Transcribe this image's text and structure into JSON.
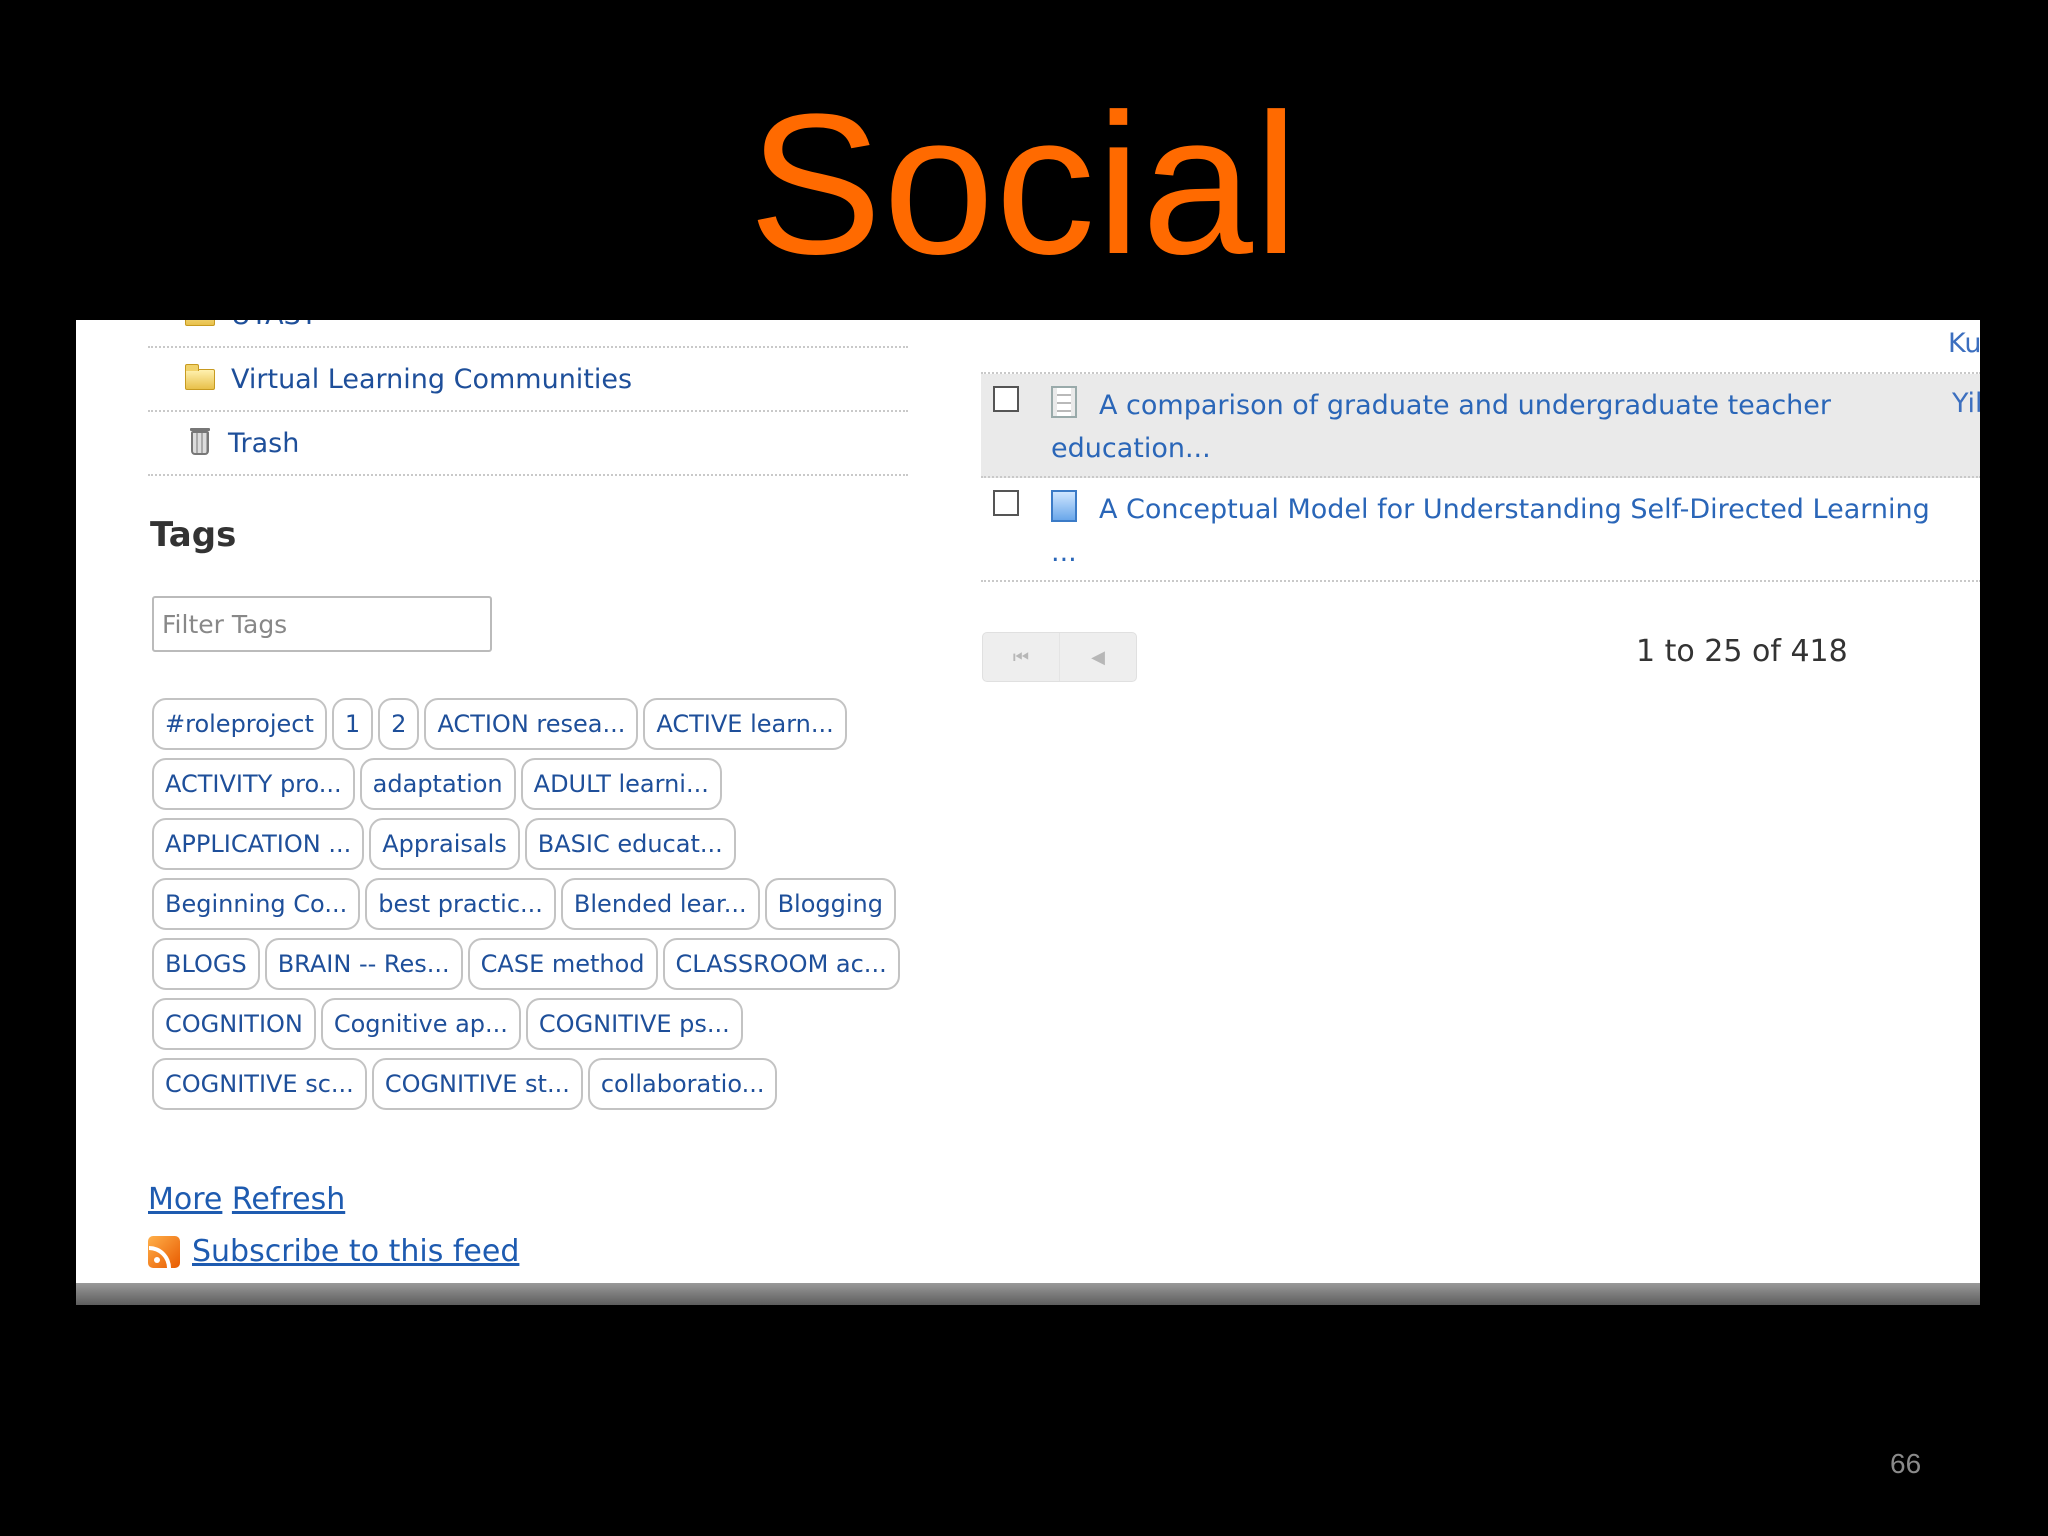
{
  "slide": {
    "title": "Social",
    "number": "66",
    "title_color": "#ff6a00"
  },
  "sidebar": {
    "folder_partial": "UTAST",
    "folders": [
      {
        "label": "Virtual Learning Communities",
        "icon": "folder-icon"
      },
      {
        "label": "Trash",
        "icon": "trash-icon"
      }
    ],
    "tags_heading": "Tags",
    "tag_filter_placeholder": "Filter Tags",
    "tags": [
      "#roleproject",
      "1",
      "2",
      "ACTION resea...",
      "ACTIVE learn...",
      "ACTIVITY pro...",
      "adaptation",
      "ADULT learni...",
      "APPLICATION ...",
      "Appraisals",
      "BASIC educat...",
      "Beginning Co...",
      "best practic...",
      "Blended lear...",
      "Blogging",
      "BLOGS",
      "BRAIN -- Res...",
      "CASE method",
      "CLASSROOM ac...",
      "COGNITION",
      "Cognitive ap...",
      "COGNITIVE ps...",
      "COGNITIVE sc...",
      "COGNITIVE st...",
      "collaboratio..."
    ],
    "more_label": "More",
    "refresh_label": "Refresh",
    "subscribe_label": "Subscribe to this feed"
  },
  "library": {
    "top_author_partial": "Ku",
    "documents": [
      {
        "title": "A comparison of graduate and undergraduate teacher education...",
        "author": "Yil",
        "icon": "text-document-icon",
        "highlighted": true
      },
      {
        "title": "A Conceptual Model for Understanding Self-Directed Learning ...",
        "author": "",
        "icon": "blue-document-icon",
        "highlighted": false
      }
    ],
    "pager_first": "⏮",
    "pager_prev": "◀",
    "count": "1 to 25 of 418"
  }
}
